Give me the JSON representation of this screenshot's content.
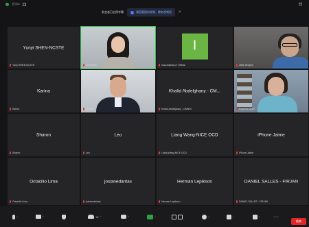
{
  "window": {
    "meeting_id": "会议ID",
    "top_right_glyph": "器"
  },
  "banner": {
    "text": "参会者已启用字幕",
    "link": "请您截图的视频，需有视频权",
    "close": "×"
  },
  "participants": [
    {
      "name": "Yunyi SHEN-NCSTE",
      "label": "Yunyi SHEN-NCSTE",
      "video": false
    },
    {
      "name": "",
      "label": "JYM NICE",
      "video": true,
      "speaking": true
    },
    {
      "name": "",
      "label": "Iuak Adamou-T OMNZ",
      "video": false,
      "avatar_letter": "I"
    },
    {
      "name": "",
      "label": "Uttar Bergers",
      "video": true
    },
    {
      "name": "Karina",
      "label": "Karina",
      "video": false
    },
    {
      "name": "",
      "label": "Chenlei",
      "video": true
    },
    {
      "name": "Khalid Abdelghany - CM...",
      "label": "Khalid Abdelghany - OMNDI",
      "video": false
    },
    {
      "name": "",
      "label": "Eugenia Ogum",
      "video": true
    },
    {
      "name": "Sharon",
      "label": "Sharon",
      "video": false
    },
    {
      "name": "Leo",
      "label": "Leo",
      "video": false
    },
    {
      "name": "Liang Wang-NICE OCD",
      "label": "Liang Wang-NICE OCD",
      "video": false
    },
    {
      "name": "iPhone Jaime",
      "label": "iPhone Jaime",
      "video": false
    },
    {
      "name": "Octacilio Lima",
      "label": "Octacilio Lima",
      "video": false
    },
    {
      "name": "josianedantas",
      "label": "josianedantas",
      "video": false
    },
    {
      "name": "Herman Lepikson",
      "label": "Herman Lepikson",
      "video": false
    },
    {
      "name": "DANIEL SALLES - FIRJAN",
      "label": "DANIEL SALLES - FIRJAN",
      "video": false
    }
  ],
  "toolbar": {
    "participant_count": "16",
    "leave_label": "结束",
    "caret": "^",
    "more": "···"
  },
  "colors": {
    "speaking_border": "#33c14a",
    "muted_mic": "#e23c3c",
    "leave_button": "#e02828",
    "avatar_green": "#6ab544"
  }
}
